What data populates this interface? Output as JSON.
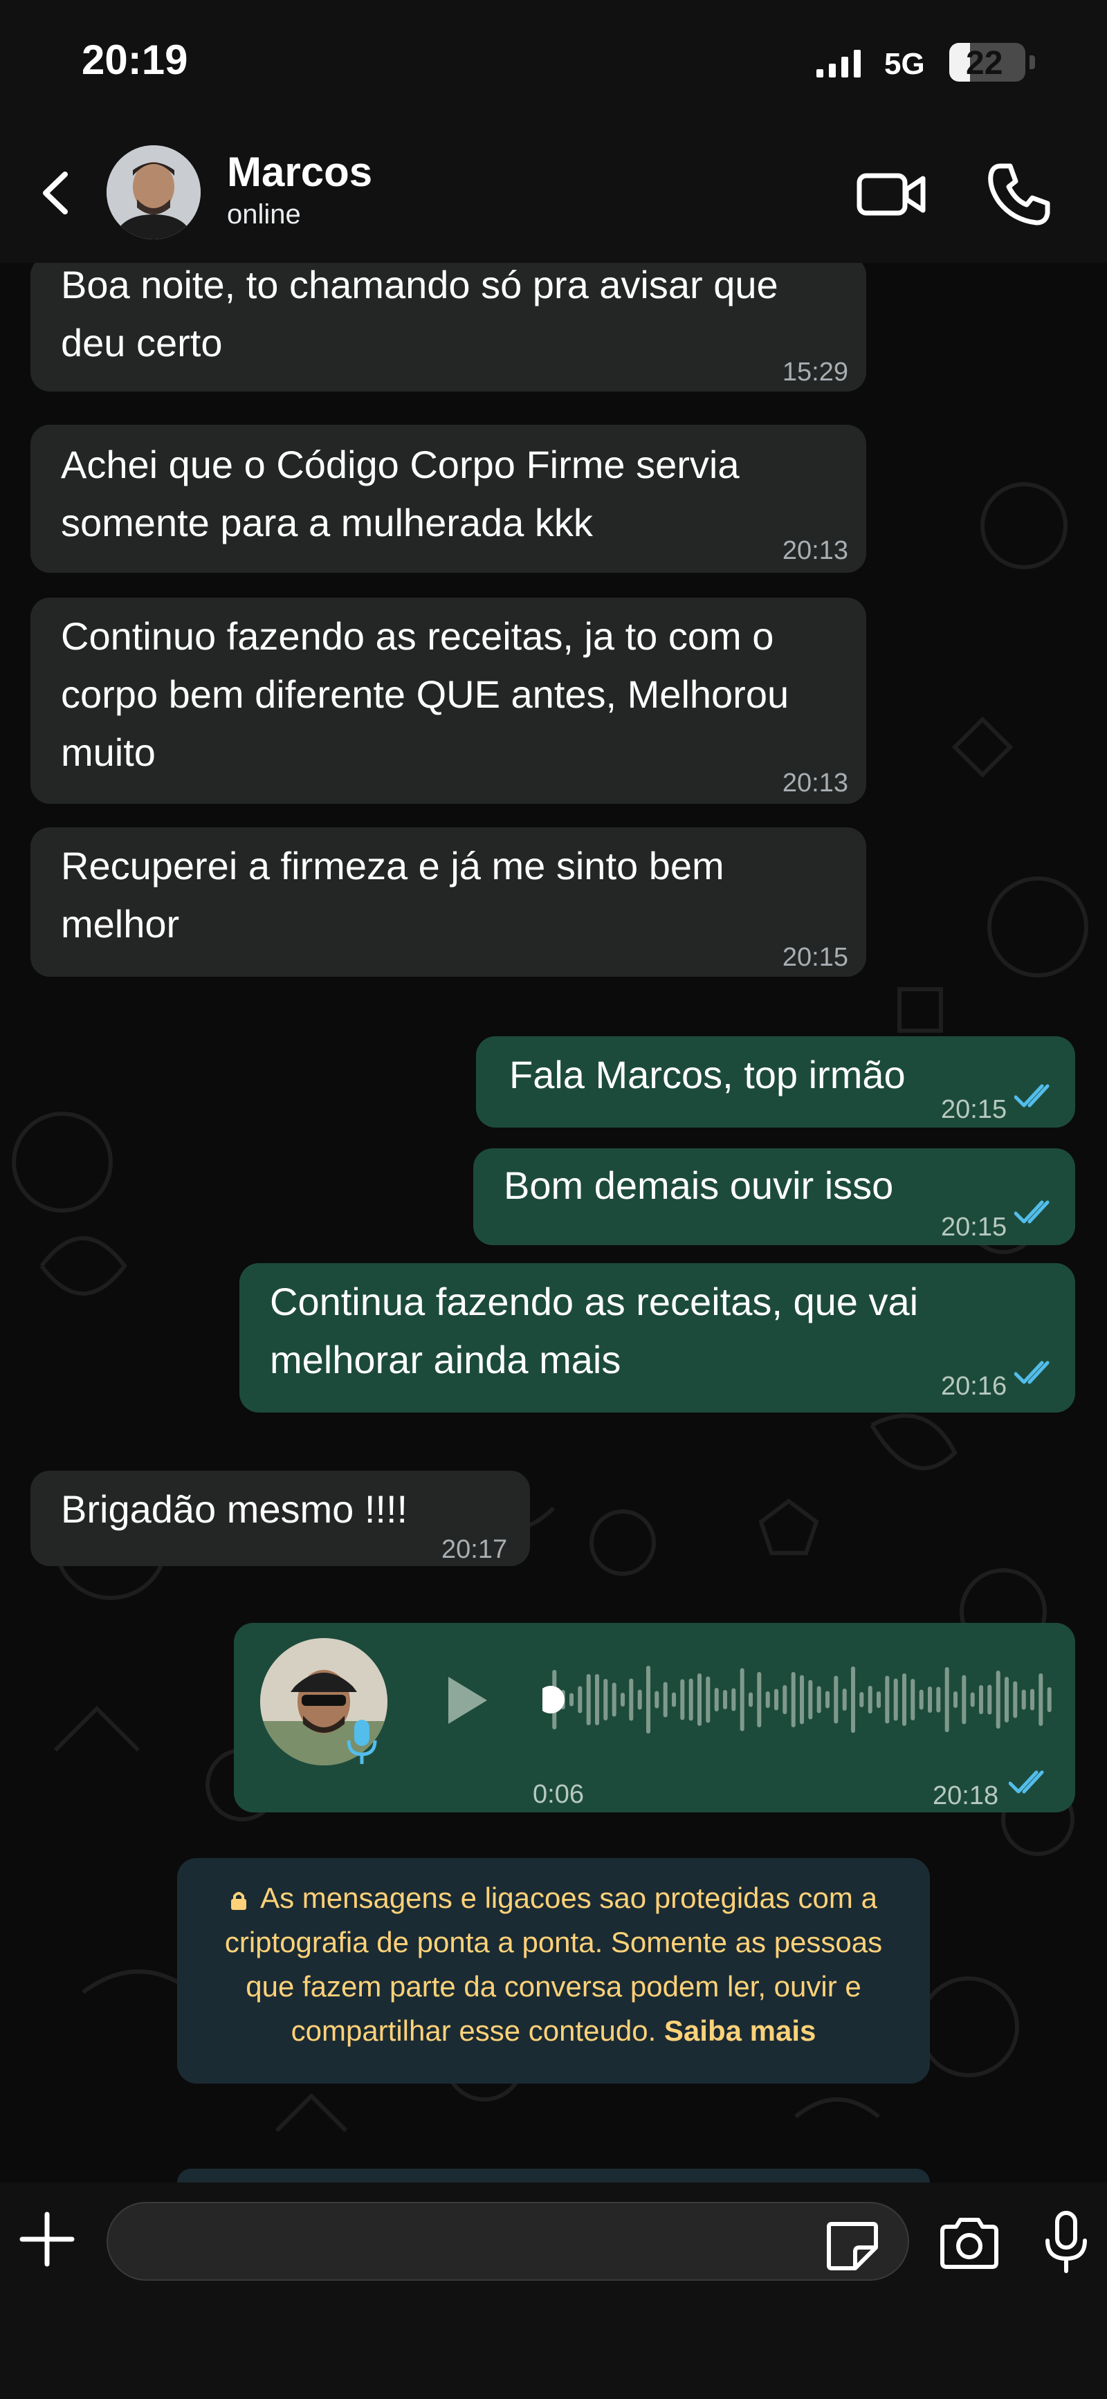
{
  "status_bar": {
    "time": "20:19",
    "network": "5G",
    "battery": "22"
  },
  "header": {
    "contact_name": "Marcos",
    "contact_status": "online"
  },
  "messages": [
    {
      "direction": "in",
      "text": "Boa noite, to chamando só pra avisar que deu certo",
      "time": "15:29"
    },
    {
      "direction": "in",
      "text": "Achei que o Código Corpo Firme servia somente para a mulherada kkk",
      "time": "20:13"
    },
    {
      "direction": "in",
      "text": "Continuo fazendo as receitas, ja to com o corpo bem diferente QUE antes, Melhorou muito",
      "time": "20:13"
    },
    {
      "direction": "in",
      "text": "Recuperei a firmeza e já me sinto bem melhor",
      "time": "20:15"
    },
    {
      "direction": "out",
      "text": "Fala Marcos, top irmão",
      "time": "20:15",
      "status": "read"
    },
    {
      "direction": "out",
      "text": "Bom demais ouvir isso",
      "time": "20:15",
      "status": "read"
    },
    {
      "direction": "out",
      "text": "Continua fazendo as receitas, que vai melhorar ainda mais",
      "time": "20:16",
      "status": "read"
    },
    {
      "direction": "in",
      "text": "Brigadão mesmo !!!!",
      "time": "20:17"
    }
  ],
  "voice_message": {
    "duration": "0:06",
    "time": "20:18",
    "progress": 0,
    "status": "read"
  },
  "system_note": {
    "text": "As mensagens e ligacoes sao protegidas com a criptografia de ponta a ponta. Somente as pessoas que fazem parte da conversa podem ler, ouvir e compartilhar esse conteudo.",
    "link": "Saiba mais"
  },
  "composer": {
    "value": "",
    "placeholder": ""
  },
  "colors": {
    "incoming": "#242626",
    "outgoing": "#1d4b3b",
    "read_ticks": "#53bdeb",
    "note_text": "#ffd279"
  }
}
